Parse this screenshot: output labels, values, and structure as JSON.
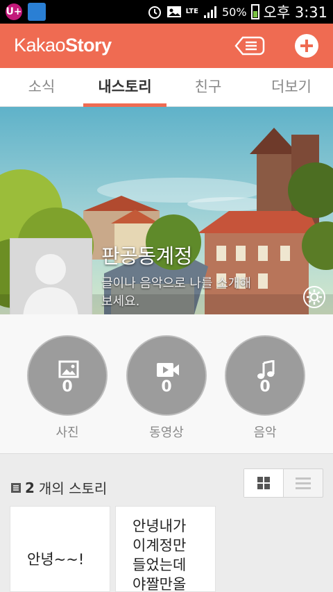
{
  "status_bar": {
    "carrier_icon": "U+",
    "lte": "LTE",
    "battery": "50%",
    "time": "오후 3:31"
  },
  "app": {
    "logo_light": "Kakao",
    "logo_bold": "Story",
    "icons": {
      "menu": "list-menu-icon",
      "add": "plus-icon"
    },
    "accent": "#ef6b52"
  },
  "tabs": [
    {
      "label": "소식",
      "active": false
    },
    {
      "label": "내스토리",
      "active": true
    },
    {
      "label": "친구",
      "active": false
    },
    {
      "label": "더보기",
      "active": false
    }
  ],
  "profile": {
    "name": "판공동계정",
    "intro": "글이나 음악으로 나를 소개해보세요."
  },
  "media": [
    {
      "label": "사진",
      "count": "0",
      "icon": "photo-icon"
    },
    {
      "label": "동영상",
      "count": "0",
      "icon": "video-icon"
    },
    {
      "label": "음악",
      "count": "0",
      "icon": "music-note-icon"
    }
  ],
  "stories": {
    "count": "2",
    "count_suffix": "개의 스토리",
    "items": [
      {
        "text": "안녕~~!"
      },
      {
        "text": "안녕내가\n이계정만\n들었는데\n야짤만올"
      }
    ]
  }
}
